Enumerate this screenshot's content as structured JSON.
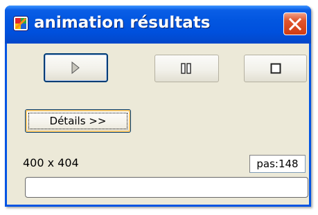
{
  "window": {
    "title": "animation résultats",
    "app_icon": "colorful-app-icon",
    "close_icon": "close-icon"
  },
  "controls": {
    "play_icon": "play-icon",
    "pause_icon": "pause-icon",
    "stop_icon": "stop-icon",
    "details_label": "Détails >>"
  },
  "status": {
    "dimensions": "400 x 404",
    "step": "pas:148",
    "progress_fraction": 0
  },
  "colors": {
    "titlebar": "#0054e3",
    "client_background": "#ece9d8",
    "close_button": "#e0552d",
    "focus_border": "#003c74"
  }
}
